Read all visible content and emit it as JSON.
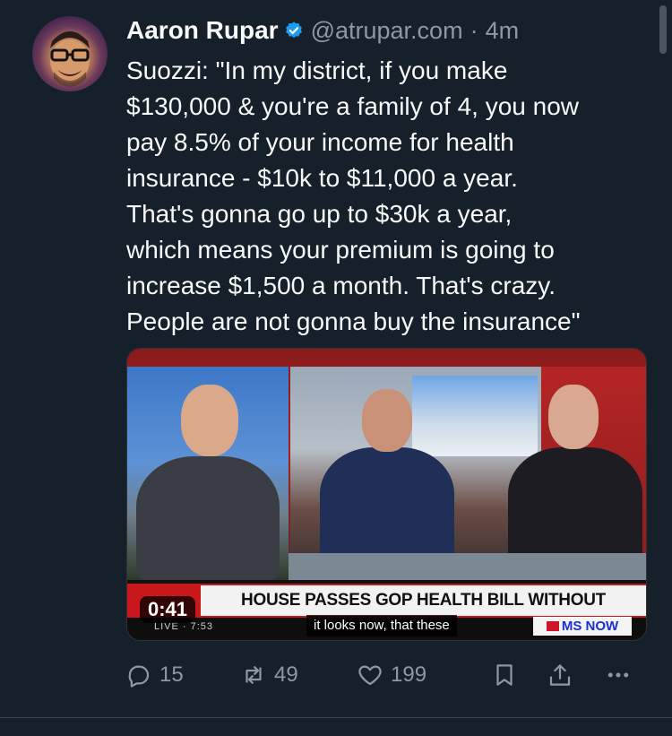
{
  "tweet": {
    "author_name": "Aaron Rupar",
    "handle": "@atrupar.com",
    "separator": "·",
    "time_ago": "4m",
    "text": "Suozzi: \"In my district, if you make\n$130,000 & you're a family of 4, you now\npay 8.5% of your income for health\ninsurance - $10k to $11,000 a year.\nThat's gonna go up to $30k a year,\nwhich means your premium is going to\nincrease $1,500 a month. That's crazy.\nPeople are not gonna buy the insurance\""
  },
  "video": {
    "duration": "0:41",
    "chyron": "HOUSE PASSES GOP HEALTH BILL WITHOUT SUBSIDIES",
    "live_label": "LIVE · 7:53",
    "caption": "it looks now, that these",
    "network": "MS NOW"
  },
  "actions": {
    "replies": "15",
    "reposts": "49",
    "likes": "199"
  },
  "colors": {
    "background": "#15202b",
    "secondary_text": "#8b98a5",
    "verified_blue": "#1d9bf0"
  }
}
